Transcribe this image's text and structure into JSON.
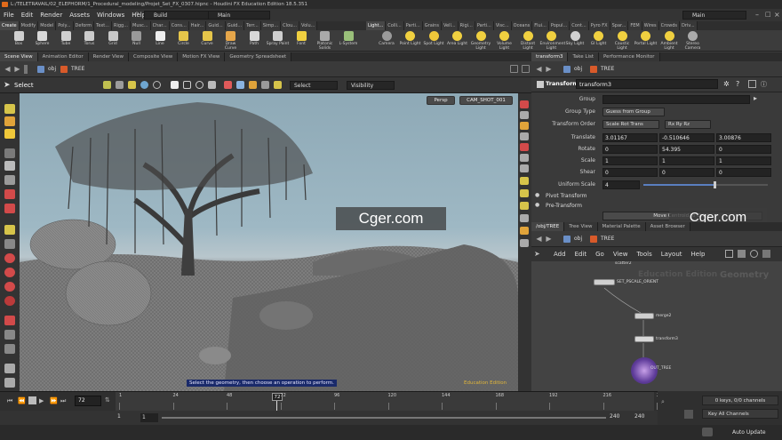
{
  "window": {
    "title": "L:/TELETRAVAIL/02_ELEPHORM/1_Procedural_modeling/Projet_Set_FX_0307.hipnc - Houdini FX Education Edition 18.5.351"
  },
  "menu": [
    "File",
    "Edit",
    "Render",
    "Assets",
    "Windows",
    "Help"
  ],
  "desktop": {
    "left": "Build",
    "right": "Main"
  },
  "shelf_tabs_left": [
    "Create",
    "Modify",
    "Model",
    "Poly...",
    "Deform",
    "Text...",
    "Rigg...",
    "Musc...",
    "Char...",
    "Cons...",
    "Hair...",
    "Guid...",
    "Guid...",
    "Terr...",
    "Simp...",
    "Clou...",
    "Volu..."
  ],
  "shelf_tabs_right": [
    "Light...",
    "Colli...",
    "Parti...",
    "Grains",
    "Vell...",
    "Rigi...",
    "Parti...",
    "Visc...",
    "Oceans",
    "Flui...",
    "Popul...",
    "Cont...",
    "Pyro FX",
    "Spar...",
    "FEM",
    "Wires",
    "Crowds",
    "Driv..."
  ],
  "tools_left": [
    "Box",
    "Sphere",
    "Tube",
    "Torus",
    "Grid",
    "Null",
    "Line",
    "Circle",
    "Curve",
    "Draw Curve",
    "Path",
    "Spray Paint",
    "Font",
    "Platonic Solids",
    "L-System"
  ],
  "tools_right": [
    "Camera",
    "Point Light",
    "Spot Light",
    "Area Light",
    "Geometry Light",
    "Volume Light",
    "Distant Light",
    "Environment Light",
    "Sky Light",
    "GI Light",
    "Caustic Light",
    "Portal Light",
    "Ambient Light",
    "Stereo Camera"
  ],
  "viewer_tabs": [
    "Scene View",
    "Animation Editor",
    "Render View",
    "Composite View",
    "Motion FX View",
    "Geometry Spreadsheet"
  ],
  "viewer_path": {
    "context": "obj",
    "node": "TREE"
  },
  "viewer_toolbar": {
    "select_label": "Select",
    "select_mode": "Select",
    "visibility": "Visibility"
  },
  "viewport": {
    "persp": "Persp",
    "camera": "CAM_SHOT_001",
    "hint": "Select the geometry, then choose an operation to perform.",
    "edition": "Education Edition"
  },
  "param_tabs": [
    "transform3",
    "Take List",
    "Performance Monitor"
  ],
  "param_path": {
    "context": "obj",
    "node": "TREE"
  },
  "param_header": {
    "type": "Transform",
    "name": "transform3"
  },
  "params": [
    {
      "label": "Group",
      "values": [
        ""
      ]
    },
    {
      "label": "Group Type",
      "values": [
        "Guess from Group"
      ]
    },
    {
      "label": "Transform Order",
      "values": [
        "Scale Rot Trans",
        "Rx Ry Rz"
      ]
    },
    {
      "label": "Translate",
      "values": [
        "3.01167",
        "-0.510646",
        "3.00876"
      ]
    },
    {
      "label": "Rotate",
      "values": [
        "0",
        "54.395",
        "0"
      ]
    },
    {
      "label": "Scale",
      "values": [
        "1",
        "1",
        "1"
      ]
    },
    {
      "label": "Shear",
      "values": [
        "0",
        "0",
        "0"
      ]
    },
    {
      "label": "Uniform Scale",
      "values": [
        "4"
      ]
    }
  ],
  "uniform_scale_fraction": 0.57,
  "param_sections": [
    "Pivot Transform",
    "Pre-Transform"
  ],
  "param_button": "Move Centroid to Origin",
  "net_tabs": [
    "/obj/TREE",
    "Tree View",
    "Material Palette",
    "Asset Browser"
  ],
  "net_path": {
    "context": "obj",
    "node": "TREE"
  },
  "net_menu": [
    "Add",
    "Edit",
    "Go",
    "View",
    "Tools",
    "Layout",
    "Help"
  ],
  "net_watermark": {
    "edition": "Education Edition",
    "context": "Geometry"
  },
  "nodes": [
    "scatter2",
    "SET_PSCALE_ORIENT",
    "merge2",
    "transform3",
    "OUT_TREE"
  ],
  "timeline": {
    "frame": "72",
    "ticks": [
      "1",
      "24",
      "48",
      "72",
      "96",
      "120",
      "144",
      "168",
      "192",
      "216",
      "240"
    ]
  },
  "range": {
    "start1": "1",
    "start2": "1",
    "end1": "240",
    "end2": "240"
  },
  "keys": {
    "info": "0 keys, 0/0 channels",
    "channels": "Key All Channels"
  },
  "autoupdate": "Auto Update",
  "watermark": "Cger.com"
}
